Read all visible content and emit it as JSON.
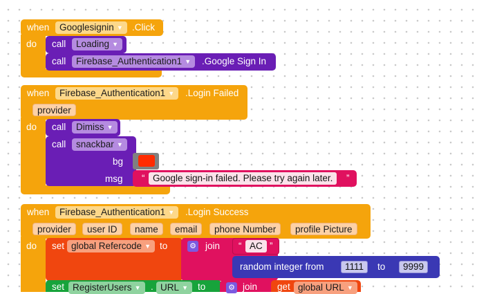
{
  "block1": {
    "when": "when",
    "component": "Googlesignin",
    "event": ".Click",
    "do": "do",
    "call1": "call",
    "call1_component": "Loading",
    "call2": "call",
    "call2_component": "Firebase_Authentication1",
    "call2_method": ".Google Sign In"
  },
  "block2": {
    "when": "when",
    "component": "Firebase_Authentication1",
    "event": ".Login Failed",
    "param": "provider",
    "do": "do",
    "call1": "call",
    "call1_component": "Dimiss",
    "call2": "call",
    "call2_component": "snackbar",
    "bg_label": "bg",
    "msg_label": "msg",
    "msg_text": "Google sign-in failed. Please try again later.",
    "bg_color": "#ff2b00"
  },
  "block3": {
    "when": "when",
    "component": "Firebase_Authentication1",
    "event": ".Login Success",
    "params": [
      "provider",
      "user ID",
      "name",
      "email",
      "phone Number",
      "profile Picture"
    ],
    "do": "do",
    "set1": "set",
    "set1_var": "global Refercode",
    "to": "to",
    "join": "join",
    "str_ac": "AC",
    "random_label": "random integer from",
    "random_from": "1111",
    "random_to_label": "to",
    "random_to": "9999",
    "set2": "set",
    "set2_component": "RegisterUsers",
    "set2_prop": "URL",
    "set2_to": "to",
    "join2": "join",
    "get": "get",
    "get_var": "global URL"
  },
  "colors": {
    "event_orange": "#f5a40c",
    "procedure_purple": "#6a1eb5",
    "variable_red": "#f0460f",
    "text_pink": "#e0115f",
    "setter_green": "#17a33b",
    "math_blue": "#3a38b4"
  },
  "icons": {
    "dropdown": "chevron-down-icon",
    "mutator": "gear-icon",
    "quote": "quote-icon"
  }
}
